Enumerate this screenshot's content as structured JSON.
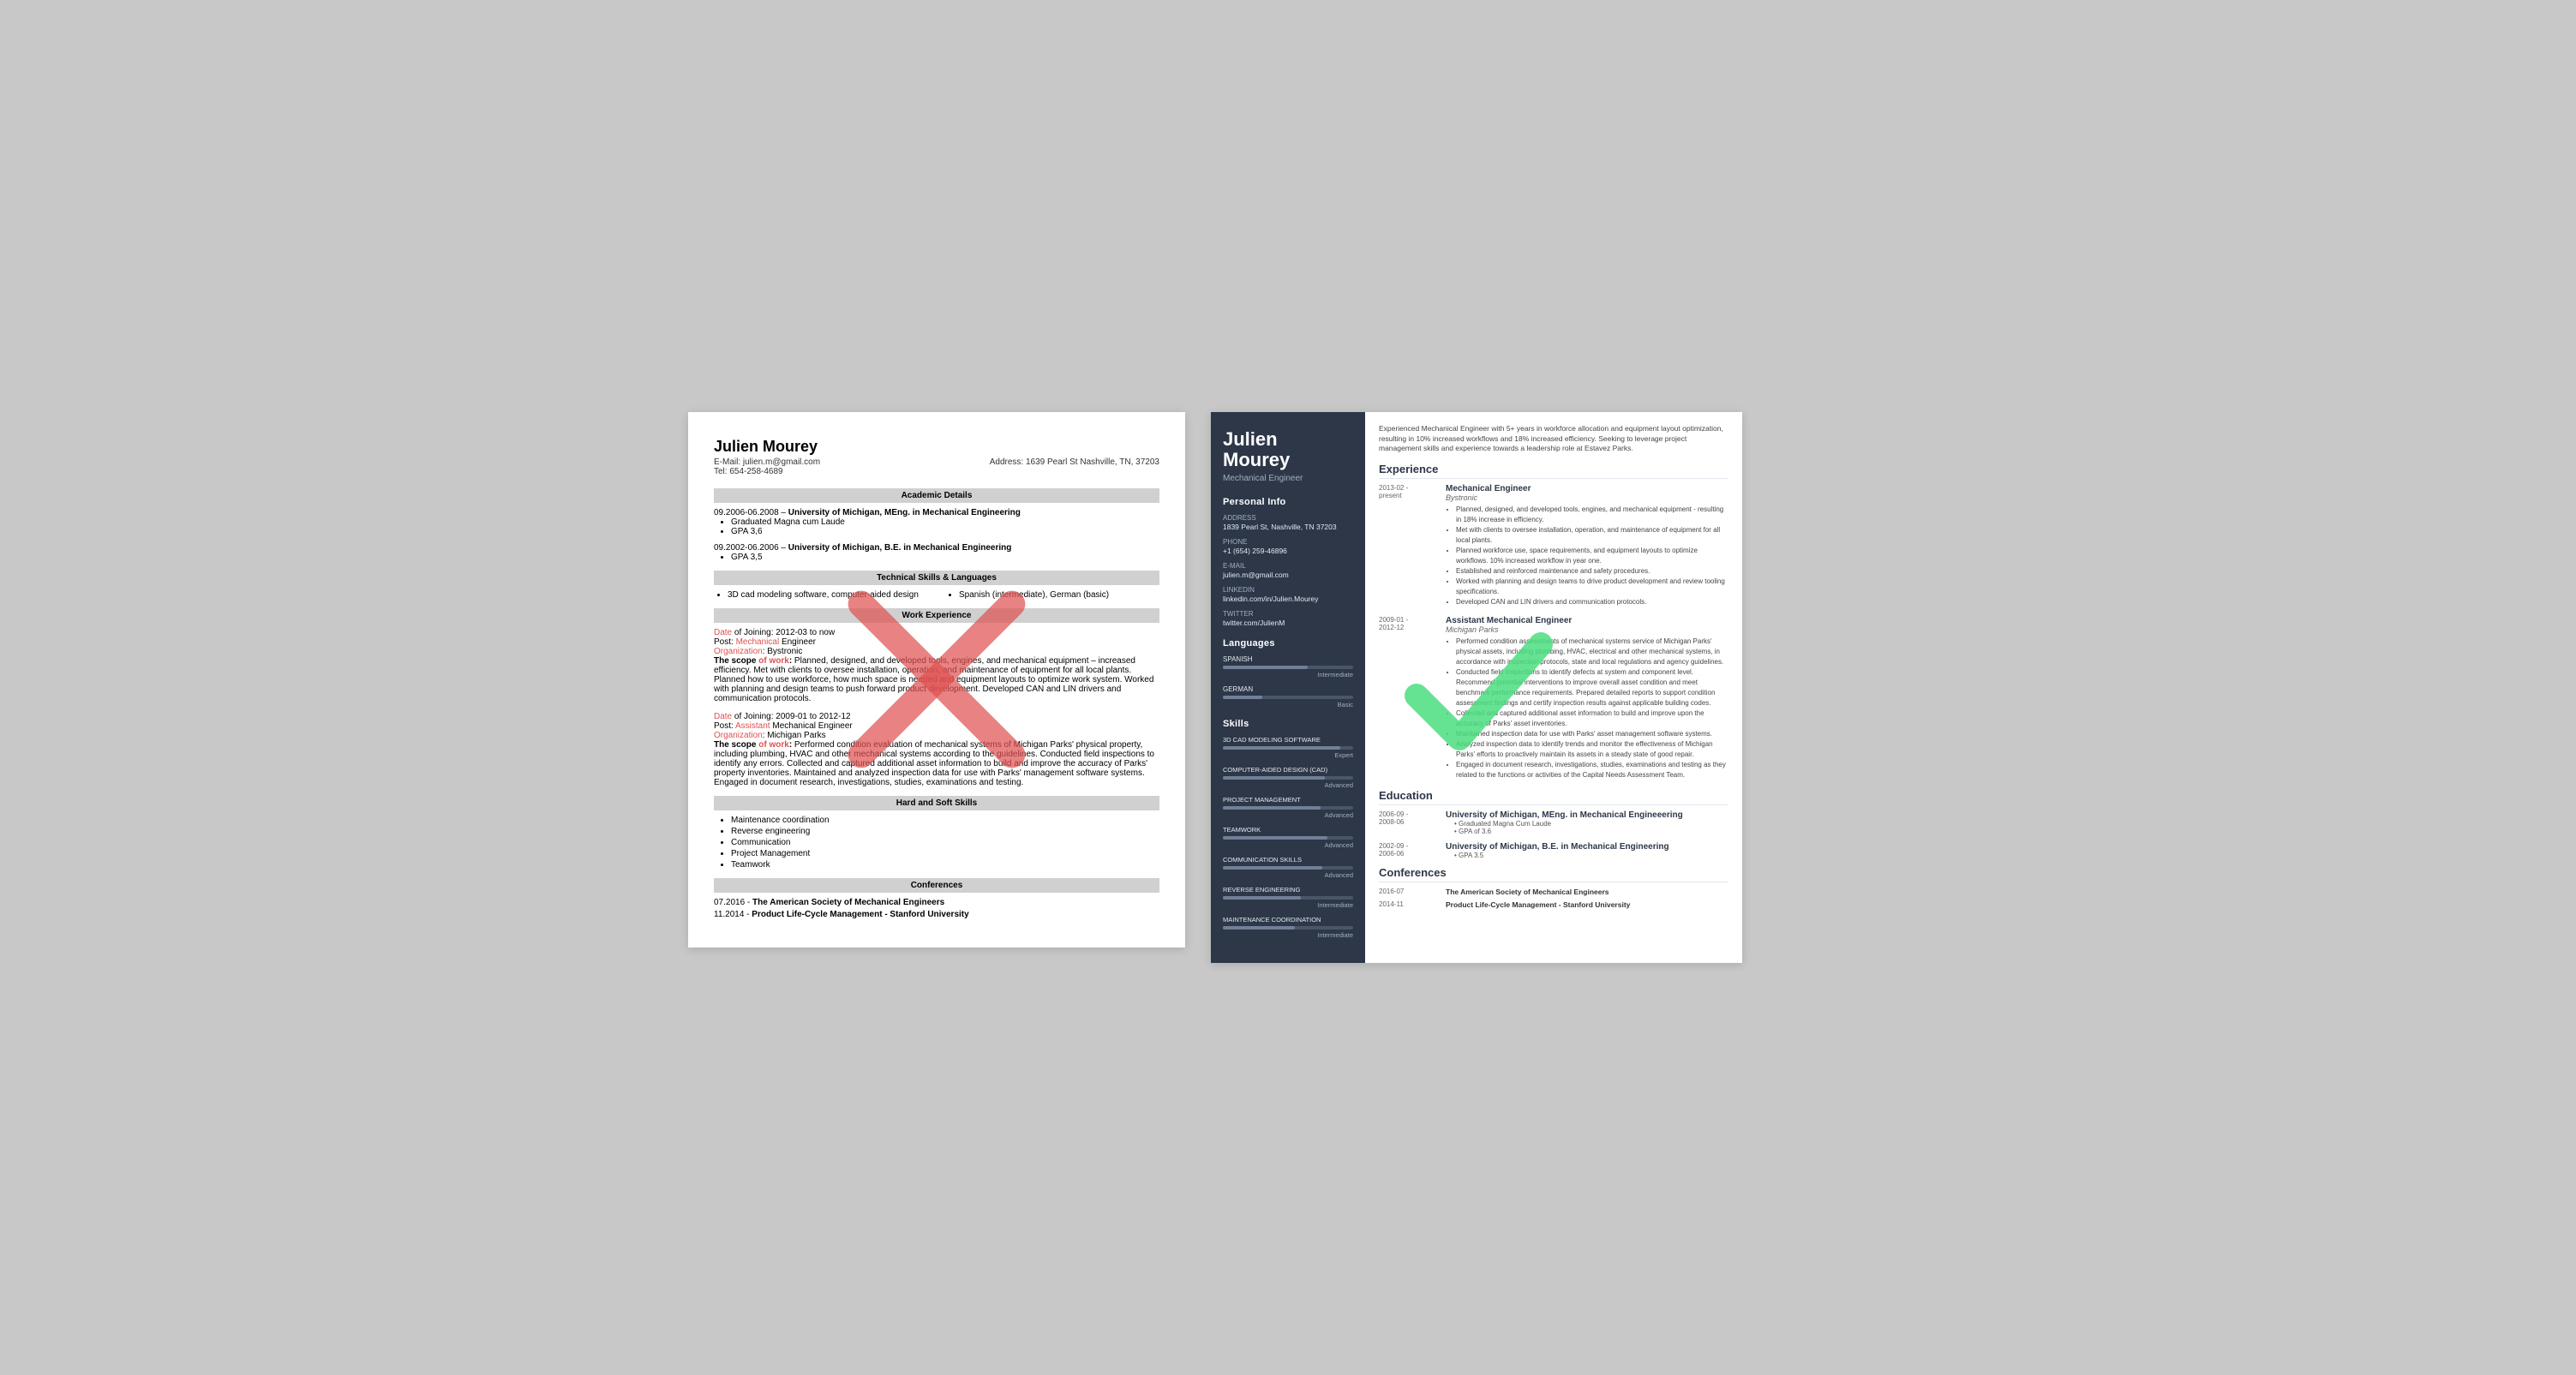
{
  "leftResume": {
    "name": "Julien Mourey",
    "email": "E-Mail: julien.m@gmail.com",
    "tel": "Tel: 654-258-4689",
    "address": "Address: 1639 Pearl St Nashville, TN, 37203",
    "sections": {
      "academic": "Academic Details",
      "technicalSkills": "Technical Skills & Languages",
      "workExperience": "Work Experience",
      "hardSoftSkills": "Hard and Soft Skills",
      "conferences": "Conferences"
    },
    "education": [
      {
        "period": "09.2006-06.2008",
        "dash": "–",
        "school": "University of Michigan, MEng. in Mechanical Engineering",
        "bullets": [
          "Graduated Magna cum Laude",
          "GPA 3,6"
        ]
      },
      {
        "period": "09.2002-06.2006",
        "dash": "–",
        "school": "University of Michigan, B.E. in Mechanical Engineering",
        "bullets": [
          "GPA 3,5"
        ]
      }
    ],
    "skills": [
      "3D cad modeling software, computer-aided design",
      "Spanish (intermediate), German (basic)"
    ],
    "workItems": [
      {
        "dateLabel": "Date",
        "dateValue": " of Joining:",
        "dateRange": " 2012-03 to now",
        "postLabel": "Post:",
        "postValue": " Mechanical Engineer",
        "orgLabel": "Organization:",
        "orgValue": " Bystronic",
        "scopeLabel": "The scope",
        "scopeValue": " of work:",
        "scopeText": " Planned, designed, and developed tools, engines, and mechanical equipment – increased efficiency. Met with clients to oversee installation, operation, and maintenance of equipment for all local plants. Planned how to use workforce, how much space is needed and equipment layouts to optimize work system. Worked with planning and design teams to push forward product development. Developed CAN and LIN drivers and communication protocols."
      },
      {
        "dateLabel": "Date",
        "dateValue": " of Joining:",
        "dateRange": " 2009-01 to 2012-12",
        "postLabel": "Post:",
        "postValue": " Assistant Mechanical Engineer",
        "orgLabel": "Organization:",
        "orgValue": " Michigan Parks",
        "scopeLabel": "The scope",
        "scopeValue": " of work:",
        "scopeText": " Performed condition evaluation of mechanical systems of Michigan Parks' physical property, including plumbing, HVAC and other mechanical systems according to the guidelines. Conducted field inspections to identify any errors. Collected and captured additional asset information to build and improve the accuracy of Parks' property inventories. Maintained and analyzed inspection data for use with Parks' management software systems. Engaged in document research, investigations, studies, examinations and testing."
      }
    ],
    "hardSkills": [
      "Maintenance coordination",
      "Reverse engineering",
      "Communication",
      "Project Management",
      "Teamwork"
    ],
    "confs": [
      {
        "date": "07.2016 -",
        "text": "The American Society of Mechanical Engineers"
      },
      {
        "date": "11.2014 -",
        "text": "Product Life-Cycle Management - Stanford University"
      }
    ]
  },
  "rightResume": {
    "name": "Julien\nMourey",
    "title": "Mechanical Engineer",
    "personalInfo": {
      "sectionTitle": "Personal Info",
      "addressLabel": "Address",
      "addressValue": "1839 Pearl St, Nashville, TN 37203",
      "phoneLabel": "Phone",
      "phoneValue": "+1 (654) 259-46896",
      "emailLabel": "E-mail",
      "emailValue": "julien.m@gmail.com",
      "linkedinLabel": "LinkedIn",
      "linkedinValue": "linkedin.com/in/Julien.Mourey",
      "twitterLabel": "Twitter",
      "twitterValue": "twitter.com/JulienM"
    },
    "languages": {
      "sectionTitle": "Languages",
      "items": [
        {
          "name": "SPANISH",
          "level": "Intermediate",
          "pct": 65
        },
        {
          "name": "GERMAN",
          "level": "Basic",
          "pct": 30
        }
      ]
    },
    "skills": {
      "sectionTitle": "Skills",
      "items": [
        {
          "name": "3D CAD MODELING SOFTWARE",
          "level": "Expert",
          "pct": 90
        },
        {
          "name": "COMPUTER-AIDED DESIGN (CAD)",
          "level": "Advanced",
          "pct": 78
        },
        {
          "name": "PROJECT MANAGEMENT",
          "level": "Advanced",
          "pct": 75
        },
        {
          "name": "TEAMWORK",
          "level": "Advanced",
          "pct": 80
        },
        {
          "name": "COMMUNICATION SKILLS",
          "level": "Advanced",
          "pct": 76
        },
        {
          "name": "REVERSE ENGINEERING",
          "level": "Intermediate",
          "pct": 60
        },
        {
          "name": "MAINTENANCE COORDINATION",
          "level": "Intermediate",
          "pct": 55
        }
      ]
    },
    "summary": "Experienced Mechanical Engineer with 5+ years in workforce allocation and equipment layout optimization, resulting in 10% increased workflows and 18% increased efficiency. Seeking to leverage project management skills and experience towards a leadership role at Estavez Parks.",
    "experienceTitle": "Experience",
    "experience": [
      {
        "dateStart": "2013-02 -",
        "dateEnd": "present",
        "jobTitle": "Mechanical Engineer",
        "company": "Bystronic",
        "bullets": [
          "Planned, designed, and developed tools, engines, and mechanical equipment - resulting in 18% increase in efficiency.",
          "Met with clients to oversee installation, operation, and maintenance of equipment for all local plants.",
          "Planned workforce use, space requirements, and equipment layouts to optimize workflows. 10% increased workflow in year one.",
          "Established and reinforced maintenance and safety procedures.",
          "Worked with planning and design teams to drive product development and review tooling specifications.",
          "Developed CAN and LIN drivers and communication protocols."
        ]
      },
      {
        "dateStart": "2009-01 -",
        "dateEnd": "2012-12",
        "jobTitle": "Assistant Mechanical Engineer",
        "company": "Michigan Parks",
        "bullets": [
          "Performed condition assessments of mechanical systems service of Michigan Parks' physical assets, including plumbing, HVAC, electrical and other mechanical systems, in accordance with inspection protocols, state and local regulations and agency guidelines.",
          "Conducted field inspections to identify defects at system and component level. Recommend potential interventions to improve overall asset condition and meet benchmark performance requirements. Prepared detailed reports to support condition assessment findings and certify inspection results against applicable building codes.",
          "Collected and captured additional asset information to build and improve upon the accuracy of Parks' asset inventories.",
          "Maintained inspection data for use with Parks' asset management software systems.",
          "Analyzed inspection data to identify trends and monitor the effectiveness of Michigan Parks' efforts to proactively maintain its assets in a steady state of good repair.",
          "Engaged in document research, investigations, studies, examinations and testing as they related to the functions or activities of the Capital Needs Assessment Team."
        ]
      }
    ],
    "educationTitle": "Education",
    "education": [
      {
        "dateStart": "2006-09 -",
        "dateEnd": "2008-06",
        "degree": "University of Michigan, MEng. in Mechanical Engineeering",
        "bullets": [
          "Graduated Magna Cum Laude",
          "GPA of 3.6"
        ]
      },
      {
        "dateStart": "2002-09 -",
        "dateEnd": "2006-06",
        "degree": "University of Michigan, B.E. in Mechanical Engineering",
        "bullets": [
          "GPA 3.5"
        ]
      }
    ],
    "conferencesTitle": "Conferences",
    "conferences": [
      {
        "date": "2016-07",
        "text": "The American Society of Mechanical Engineers"
      },
      {
        "date": "2014-11",
        "text": "Product Life-Cycle Management - Stanford University"
      }
    ]
  }
}
